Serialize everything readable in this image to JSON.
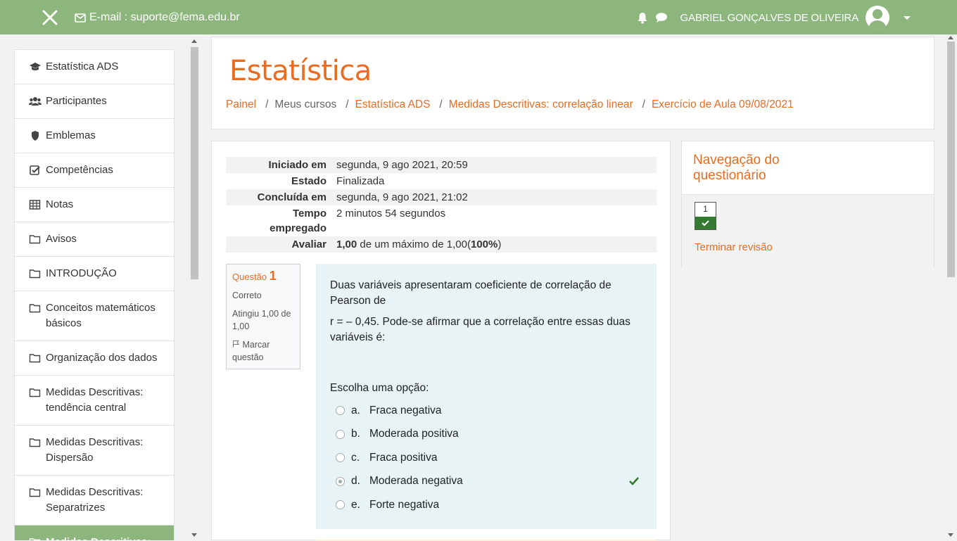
{
  "colors": {
    "topbar": "#8db67d",
    "accent": "#e96c20",
    "correct": "#357a32",
    "question_bg": "#e7f3f5"
  },
  "topbar": {
    "email": "E-mail : suporte@fema.edu.br",
    "username": "GABRIEL GONÇALVES DE OLIVEIRA"
  },
  "sidebar": {
    "items": [
      {
        "label": "Estatística ADS",
        "icon": "graduation-cap-icon"
      },
      {
        "label": "Participantes",
        "icon": "users-icon"
      },
      {
        "label": "Emblemas",
        "icon": "shield-icon"
      },
      {
        "label": "Competências",
        "icon": "checkbox-icon"
      },
      {
        "label": "Notas",
        "icon": "table-icon"
      },
      {
        "label": "Avisos",
        "icon": "folder-icon"
      },
      {
        "label": "INTRODUÇÃO",
        "icon": "folder-icon"
      },
      {
        "label": "Conceitos matemáticos básicos",
        "icon": "folder-icon"
      },
      {
        "label": "Organização dos dados",
        "icon": "folder-icon"
      },
      {
        "label": "Medidas Descritivas: tendência central",
        "icon": "folder-icon"
      },
      {
        "label": "Medidas Descritivas: Dispersão",
        "icon": "folder-icon"
      },
      {
        "label": "Medidas Descritivas: Separatrizes",
        "icon": "folder-icon"
      },
      {
        "label": "Medidas Descritivas:",
        "icon": "folder-icon"
      }
    ]
  },
  "header": {
    "title": "Estatística",
    "breadcrumb": [
      "Painel",
      "Meus cursos",
      "Estatística ADS",
      "Medidas Descritivas: correlação linear",
      "Exercício de Aula 09/08/2021"
    ]
  },
  "summary": {
    "rows": [
      {
        "label": "Iniciado em",
        "value": "segunda, 9 ago 2021, 20:59"
      },
      {
        "label": "Estado",
        "value": "Finalizada"
      },
      {
        "label": "Concluída em",
        "value": "segunda, 9 ago 2021, 21:02"
      },
      {
        "label": "Tempo empregado",
        "value": "2 minutos 54 segundos"
      }
    ],
    "grade_label": "Avaliar",
    "grade_value": "1,00",
    "grade_mid": " de um máximo de 1,00(",
    "grade_percent": "100%",
    "grade_end": ")"
  },
  "question": {
    "label": "Questão",
    "number": "1",
    "status": "Correto",
    "score": "Atingiu 1,00 de 1,00",
    "flag": "Marcar questão",
    "text1": "Duas variáveis apresentaram coeficiente de correlação de Pearson de",
    "text2": " r = – 0,45. Pode-se afirmar que a correlação entre essas duas variáveis é:",
    "prompt": "Escolha uma opção:",
    "options": [
      {
        "letter": "a.",
        "text": "Fraca negativa",
        "selected": false
      },
      {
        "letter": "b.",
        "text": "Moderada positiva",
        "selected": false
      },
      {
        "letter": "c.",
        "text": "Fraca positiva",
        "selected": false
      },
      {
        "letter": "d.",
        "text": "Moderada negativa",
        "selected": true
      },
      {
        "letter": "e.",
        "text": "Forte negativa",
        "selected": false
      }
    ]
  },
  "quiz_nav": {
    "title": "Navegação do questionário",
    "question_button": "1",
    "finish": "Terminar revisão"
  }
}
